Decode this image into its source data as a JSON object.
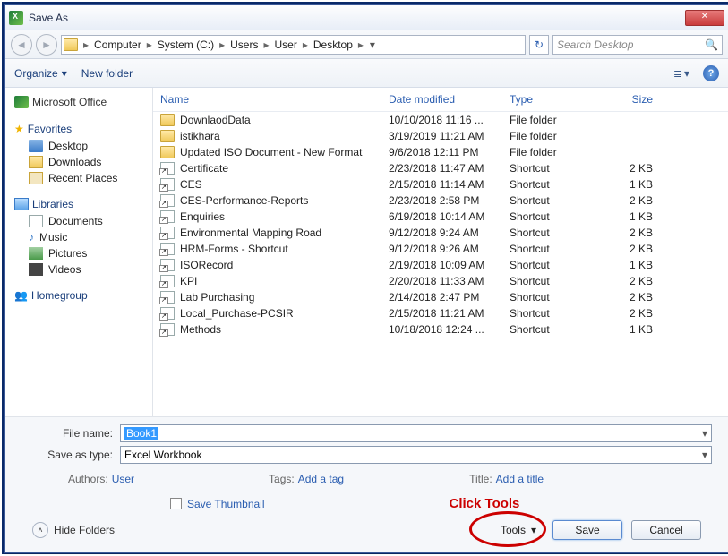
{
  "titlebar": {
    "title": "Save As"
  },
  "breadcrumb": {
    "items": [
      "Computer",
      "System (C:)",
      "Users",
      "User",
      "Desktop"
    ]
  },
  "search": {
    "placeholder": "Search Desktop"
  },
  "toolbar": {
    "organize": "Organize",
    "newfolder": "New folder"
  },
  "sidebar": {
    "ms_office": "Microsoft Office",
    "favorites": "Favorites",
    "fav_items": [
      "Desktop",
      "Downloads",
      "Recent Places"
    ],
    "libraries": "Libraries",
    "lib_items": [
      "Documents",
      "Music",
      "Pictures",
      "Videos"
    ],
    "homegroup": "Homegroup"
  },
  "columns": {
    "name": "Name",
    "date": "Date modified",
    "type": "Type",
    "size": "Size"
  },
  "files": [
    {
      "name": "DownlaodData",
      "date": "10/10/2018 11:16 ...",
      "type": "File folder",
      "size": "",
      "kind": "folder"
    },
    {
      "name": "istikhara",
      "date": "3/19/2019 11:21 AM",
      "type": "File folder",
      "size": "",
      "kind": "folder"
    },
    {
      "name": "Updated ISO Document - New Format",
      "date": "9/6/2018 12:11 PM",
      "type": "File folder",
      "size": "",
      "kind": "folder"
    },
    {
      "name": "Certificate",
      "date": "2/23/2018 11:47 AM",
      "type": "Shortcut",
      "size": "2 KB",
      "kind": "shortcut"
    },
    {
      "name": "CES",
      "date": "2/15/2018 11:14 AM",
      "type": "Shortcut",
      "size": "1 KB",
      "kind": "shortcut"
    },
    {
      "name": "CES-Performance-Reports",
      "date": "2/23/2018 2:58 PM",
      "type": "Shortcut",
      "size": "2 KB",
      "kind": "shortcut"
    },
    {
      "name": "Enquiries",
      "date": "6/19/2018 10:14 AM",
      "type": "Shortcut",
      "size": "1 KB",
      "kind": "shortcut"
    },
    {
      "name": "Environmental Mapping Road",
      "date": "9/12/2018 9:24 AM",
      "type": "Shortcut",
      "size": "2 KB",
      "kind": "shortcut"
    },
    {
      "name": "HRM-Forms - Shortcut",
      "date": "9/12/2018 9:26 AM",
      "type": "Shortcut",
      "size": "2 KB",
      "kind": "shortcut"
    },
    {
      "name": "ISORecord",
      "date": "2/19/2018 10:09 AM",
      "type": "Shortcut",
      "size": "1 KB",
      "kind": "shortcut"
    },
    {
      "name": "KPI",
      "date": "2/20/2018 11:33 AM",
      "type": "Shortcut",
      "size": "2 KB",
      "kind": "shortcut"
    },
    {
      "name": "Lab Purchasing",
      "date": "2/14/2018 2:47 PM",
      "type": "Shortcut",
      "size": "2 KB",
      "kind": "shortcut"
    },
    {
      "name": "Local_Purchase-PCSIR",
      "date": "2/15/2018 11:21 AM",
      "type": "Shortcut",
      "size": "2 KB",
      "kind": "shortcut"
    },
    {
      "name": "Methods",
      "date": "10/18/2018 12:24 ...",
      "type": "Shortcut",
      "size": "1 KB",
      "kind": "shortcut"
    }
  ],
  "form": {
    "filename_label": "File name:",
    "filename_value": "Book1",
    "savetype_label": "Save as type:",
    "savetype_value": "Excel Workbook",
    "authors_label": "Authors:",
    "authors_value": "User",
    "tags_label": "Tags:",
    "tags_value": "Add a tag",
    "title_label": "Title:",
    "title_value": "Add a title",
    "thumbnail": "Save Thumbnail"
  },
  "buttons": {
    "hide_folders": "Hide Folders",
    "tools": "Tools",
    "save": "Save",
    "cancel": "Cancel"
  },
  "annotation": {
    "click_tools": "Click Tools"
  }
}
